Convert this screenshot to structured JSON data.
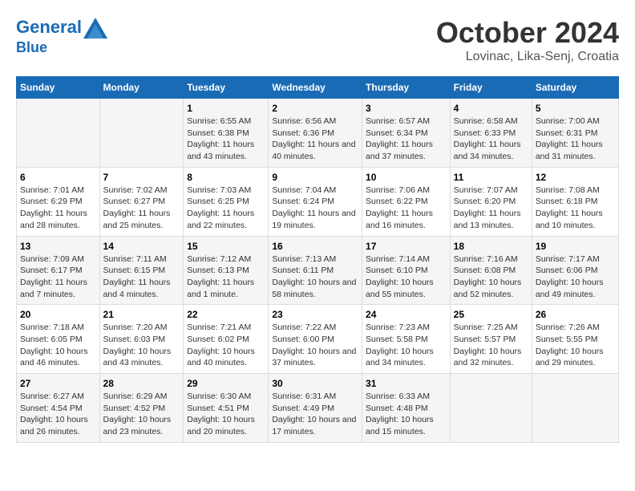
{
  "header": {
    "logo_line1": "General",
    "logo_line2": "Blue",
    "month": "October 2024",
    "location": "Lovinac, Lika-Senj, Croatia"
  },
  "days_of_week": [
    "Sunday",
    "Monday",
    "Tuesday",
    "Wednesday",
    "Thursday",
    "Friday",
    "Saturday"
  ],
  "weeks": [
    [
      {
        "day": "",
        "info": ""
      },
      {
        "day": "",
        "info": ""
      },
      {
        "day": "1",
        "info": "Sunrise: 6:55 AM\nSunset: 6:38 PM\nDaylight: 11 hours and 43 minutes."
      },
      {
        "day": "2",
        "info": "Sunrise: 6:56 AM\nSunset: 6:36 PM\nDaylight: 11 hours and 40 minutes."
      },
      {
        "day": "3",
        "info": "Sunrise: 6:57 AM\nSunset: 6:34 PM\nDaylight: 11 hours and 37 minutes."
      },
      {
        "day": "4",
        "info": "Sunrise: 6:58 AM\nSunset: 6:33 PM\nDaylight: 11 hours and 34 minutes."
      },
      {
        "day": "5",
        "info": "Sunrise: 7:00 AM\nSunset: 6:31 PM\nDaylight: 11 hours and 31 minutes."
      }
    ],
    [
      {
        "day": "6",
        "info": "Sunrise: 7:01 AM\nSunset: 6:29 PM\nDaylight: 11 hours and 28 minutes."
      },
      {
        "day": "7",
        "info": "Sunrise: 7:02 AM\nSunset: 6:27 PM\nDaylight: 11 hours and 25 minutes."
      },
      {
        "day": "8",
        "info": "Sunrise: 7:03 AM\nSunset: 6:25 PM\nDaylight: 11 hours and 22 minutes."
      },
      {
        "day": "9",
        "info": "Sunrise: 7:04 AM\nSunset: 6:24 PM\nDaylight: 11 hours and 19 minutes."
      },
      {
        "day": "10",
        "info": "Sunrise: 7:06 AM\nSunset: 6:22 PM\nDaylight: 11 hours and 16 minutes."
      },
      {
        "day": "11",
        "info": "Sunrise: 7:07 AM\nSunset: 6:20 PM\nDaylight: 11 hours and 13 minutes."
      },
      {
        "day": "12",
        "info": "Sunrise: 7:08 AM\nSunset: 6:18 PM\nDaylight: 11 hours and 10 minutes."
      }
    ],
    [
      {
        "day": "13",
        "info": "Sunrise: 7:09 AM\nSunset: 6:17 PM\nDaylight: 11 hours and 7 minutes."
      },
      {
        "day": "14",
        "info": "Sunrise: 7:11 AM\nSunset: 6:15 PM\nDaylight: 11 hours and 4 minutes."
      },
      {
        "day": "15",
        "info": "Sunrise: 7:12 AM\nSunset: 6:13 PM\nDaylight: 11 hours and 1 minute."
      },
      {
        "day": "16",
        "info": "Sunrise: 7:13 AM\nSunset: 6:11 PM\nDaylight: 10 hours and 58 minutes."
      },
      {
        "day": "17",
        "info": "Sunrise: 7:14 AM\nSunset: 6:10 PM\nDaylight: 10 hours and 55 minutes."
      },
      {
        "day": "18",
        "info": "Sunrise: 7:16 AM\nSunset: 6:08 PM\nDaylight: 10 hours and 52 minutes."
      },
      {
        "day": "19",
        "info": "Sunrise: 7:17 AM\nSunset: 6:06 PM\nDaylight: 10 hours and 49 minutes."
      }
    ],
    [
      {
        "day": "20",
        "info": "Sunrise: 7:18 AM\nSunset: 6:05 PM\nDaylight: 10 hours and 46 minutes."
      },
      {
        "day": "21",
        "info": "Sunrise: 7:20 AM\nSunset: 6:03 PM\nDaylight: 10 hours and 43 minutes."
      },
      {
        "day": "22",
        "info": "Sunrise: 7:21 AM\nSunset: 6:02 PM\nDaylight: 10 hours and 40 minutes."
      },
      {
        "day": "23",
        "info": "Sunrise: 7:22 AM\nSunset: 6:00 PM\nDaylight: 10 hours and 37 minutes."
      },
      {
        "day": "24",
        "info": "Sunrise: 7:23 AM\nSunset: 5:58 PM\nDaylight: 10 hours and 34 minutes."
      },
      {
        "day": "25",
        "info": "Sunrise: 7:25 AM\nSunset: 5:57 PM\nDaylight: 10 hours and 32 minutes."
      },
      {
        "day": "26",
        "info": "Sunrise: 7:26 AM\nSunset: 5:55 PM\nDaylight: 10 hours and 29 minutes."
      }
    ],
    [
      {
        "day": "27",
        "info": "Sunrise: 6:27 AM\nSunset: 4:54 PM\nDaylight: 10 hours and 26 minutes."
      },
      {
        "day": "28",
        "info": "Sunrise: 6:29 AM\nSunset: 4:52 PM\nDaylight: 10 hours and 23 minutes."
      },
      {
        "day": "29",
        "info": "Sunrise: 6:30 AM\nSunset: 4:51 PM\nDaylight: 10 hours and 20 minutes."
      },
      {
        "day": "30",
        "info": "Sunrise: 6:31 AM\nSunset: 4:49 PM\nDaylight: 10 hours and 17 minutes."
      },
      {
        "day": "31",
        "info": "Sunrise: 6:33 AM\nSunset: 4:48 PM\nDaylight: 10 hours and 15 minutes."
      },
      {
        "day": "",
        "info": ""
      },
      {
        "day": "",
        "info": ""
      }
    ]
  ]
}
